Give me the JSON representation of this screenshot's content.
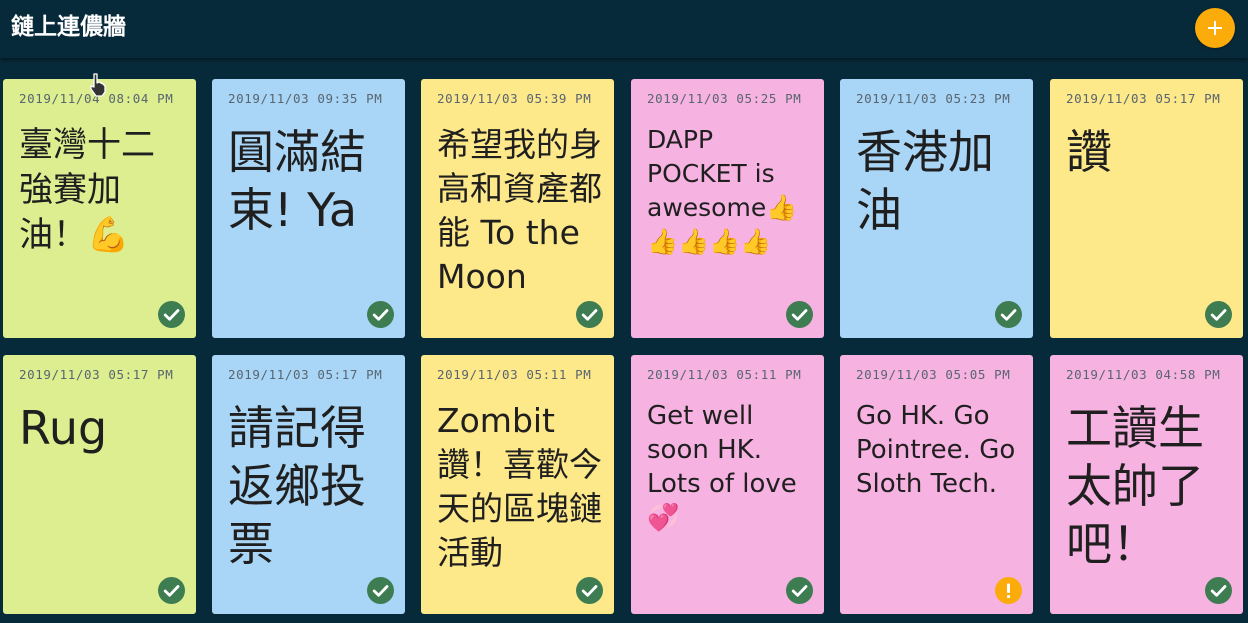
{
  "app": {
    "title": "鏈上連儂牆"
  },
  "header": {
    "add_button_icon": "plus-icon",
    "add_button_color": "#fbab0a"
  },
  "colors": {
    "green": "#dcee8f",
    "blue": "#a9d6f6",
    "yellow": "#fde88a",
    "pink": "#f6b2e1",
    "status_ok": "#3e7d52",
    "status_warn": "#fbab0a"
  },
  "notes": [
    {
      "time": "2019/11/04 08:04 PM",
      "text": "臺灣十二強賽加油！💪",
      "color": "green",
      "status": "check-circle-icon"
    },
    {
      "time": "2019/11/03 09:35 PM",
      "text": "圓滿結束! Ya",
      "color": "blue",
      "status": "check-circle-icon"
    },
    {
      "time": "2019/11/03 05:39 PM",
      "text": "希望我的身高和資產都能 To the Moon",
      "color": "yellow",
      "status": "check-circle-icon"
    },
    {
      "time": "2019/11/03 05:25 PM",
      "text": "DAPP POCKET is awesome👍👍👍👍👍",
      "color": "pink",
      "status": "check-circle-icon"
    },
    {
      "time": "2019/11/03 05:23 PM",
      "text": "香港加油",
      "color": "blue",
      "status": "check-circle-icon"
    },
    {
      "time": "2019/11/03 05:17 PM",
      "text": "讚",
      "color": "yellow",
      "status": "check-circle-icon"
    },
    {
      "time": "2019/11/03 05:17 PM",
      "text": "Rug",
      "color": "green",
      "status": "check-circle-icon"
    },
    {
      "time": "2019/11/03 05:17 PM",
      "text": "請記得返鄉投票",
      "color": "blue",
      "status": "check-circle-icon"
    },
    {
      "time": "2019/11/03 05:11 PM",
      "text": "Zombit讚！喜歡今天的區塊鏈活動",
      "color": "yellow",
      "status": "check-circle-icon"
    },
    {
      "time": "2019/11/03 05:11 PM",
      "text": "Get well soon HK. Lots of love 💞",
      "color": "pink",
      "status": "check-circle-icon"
    },
    {
      "time": "2019/11/03 05:05 PM",
      "text": "Go HK. Go Pointree. Go Sloth Tech.",
      "color": "pink",
      "status": "alert-circle-icon"
    },
    {
      "time": "2019/11/03 04:58 PM",
      "text": "工讀生太帥了吧！",
      "color": "pink",
      "status": "check-circle-icon"
    }
  ]
}
